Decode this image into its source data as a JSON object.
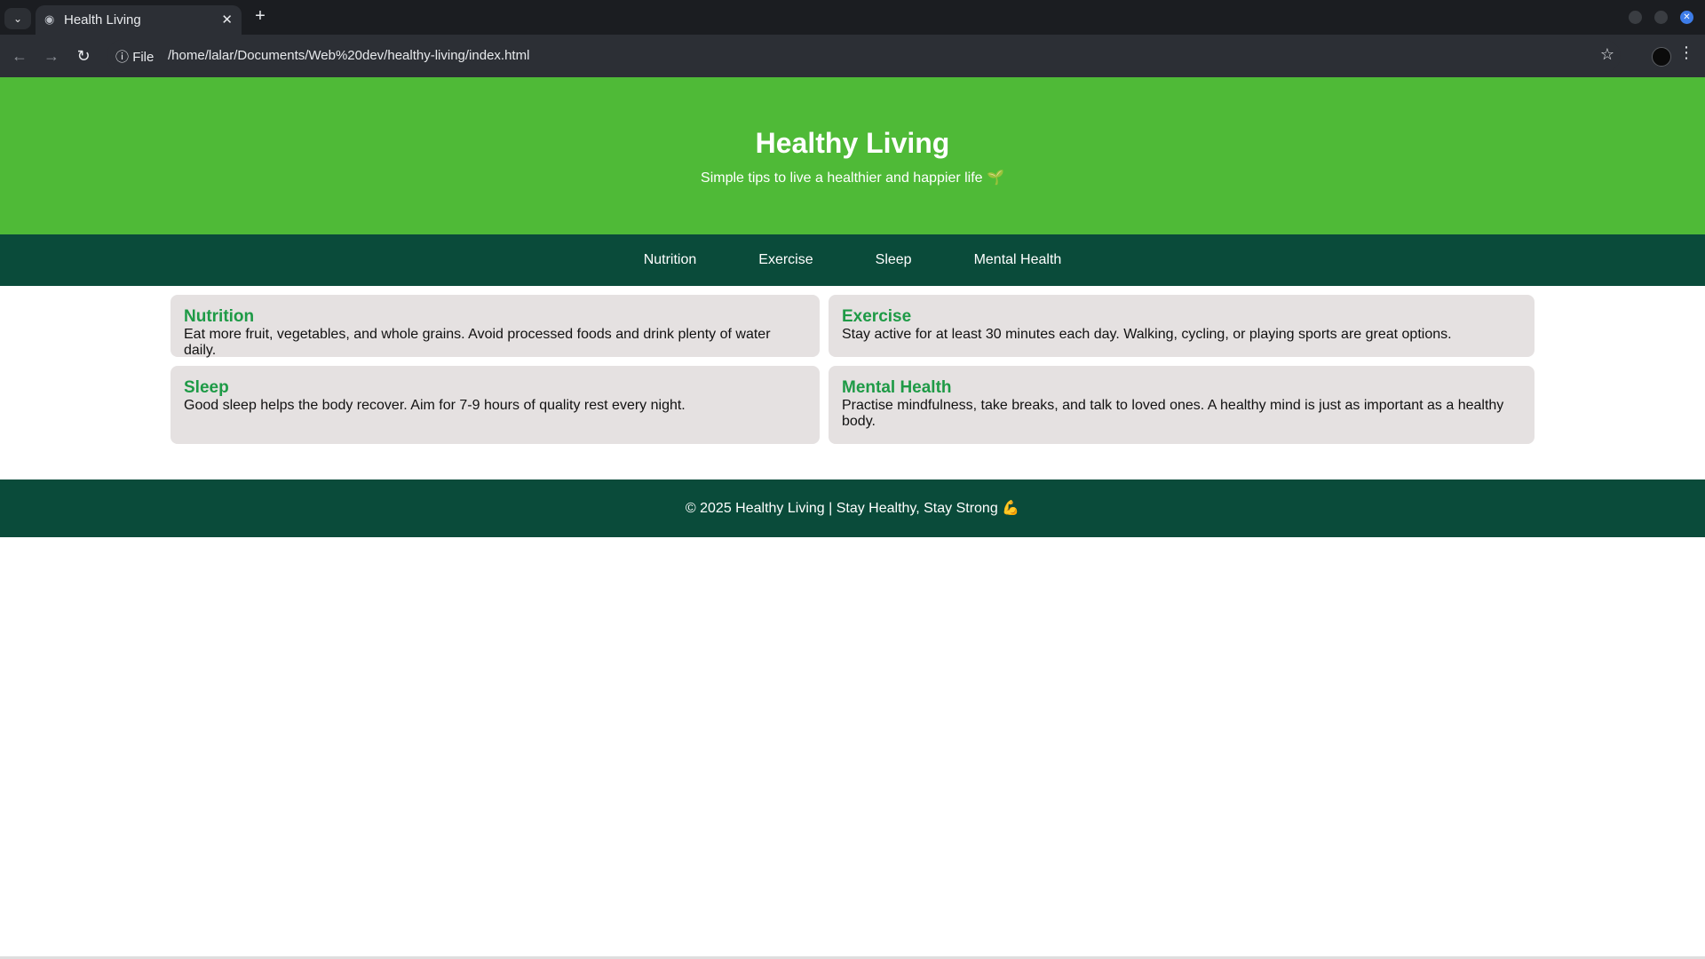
{
  "browser": {
    "tab_title": "Health Living",
    "url_scheme_label": "File",
    "url": "/home/lalar/Documents/Web%20dev/healthy-living/index.html",
    "icons": [
      "tab-list-icon",
      "globe-icon",
      "close-icon",
      "plus-icon",
      "back-icon",
      "forward-icon",
      "reload-icon",
      "info-icon",
      "star-icon",
      "profile-icon",
      "menu-icon"
    ]
  },
  "header": {
    "title": "Healthy Living",
    "subtitle": "Simple tips to live a healthier and happier life 🌱"
  },
  "nav": {
    "items": [
      "Nutrition",
      "Exercise",
      "Sleep",
      "Mental Health"
    ]
  },
  "cards": [
    {
      "title": "Nutrition",
      "body": "Eat more fruit, vegetables, and whole grains. Avoid processed foods and drink plenty of water daily."
    },
    {
      "title": "Exercise",
      "body": "Stay active for at least 30 minutes each day. Walking, cycling, or playing sports are great options."
    },
    {
      "title": "Sleep",
      "body": "Good sleep helps the body recover. Aim for 7-9 hours of quality rest every night."
    },
    {
      "title": "Mental Health",
      "body": "Practise mindfulness, take breaks, and talk to loved ones. A healthy mind is just as important as a healthy body."
    }
  ],
  "footer": {
    "text": "© 2025 Healthy Living | Stay Healthy, Stay Strong 💪"
  },
  "colors": {
    "hero_green": "#4fba37",
    "dark_green": "#0a4b3a",
    "card_title_green": "#1e9a46",
    "card_bg": "#e5e1e1"
  }
}
